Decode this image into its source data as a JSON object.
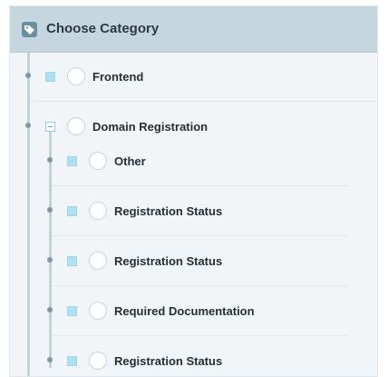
{
  "header": {
    "title": "Choose Category",
    "icon": "tag-icon"
  },
  "tree": {
    "items": [
      {
        "label": "Frontend",
        "level": 0,
        "expanded": false
      },
      {
        "label": "Domain Registration",
        "level": 0,
        "expanded": true
      },
      {
        "label": "Other",
        "level": 1
      },
      {
        "label": "Registration Status",
        "level": 1
      },
      {
        "label": "Registration Status",
        "level": 1
      },
      {
        "label": "Required Documentation",
        "level": 1
      },
      {
        "label": "Registration Status",
        "level": 1
      }
    ]
  },
  "colors": {
    "header_bg": "#c6d6df",
    "panel_bg": "#f1f5f8",
    "checkbox_fill": "#aee0f2",
    "tree_line": "#c3d1d8"
  }
}
